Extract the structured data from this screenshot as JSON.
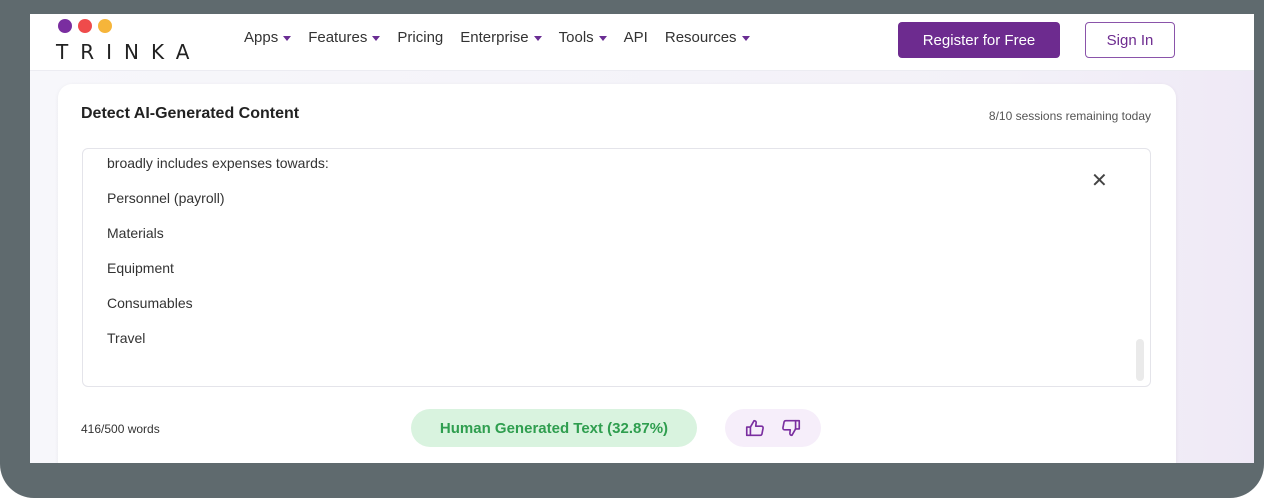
{
  "brand": {
    "name": "TRINKA",
    "dot_colors": [
      "#7a2ea0",
      "#ef4b4b",
      "#f6b53a"
    ]
  },
  "nav": {
    "items": [
      {
        "label": "Apps",
        "has_dropdown": true
      },
      {
        "label": "Features",
        "has_dropdown": true
      },
      {
        "label": "Pricing",
        "has_dropdown": false
      },
      {
        "label": "Enterprise",
        "has_dropdown": true
      },
      {
        "label": "Tools",
        "has_dropdown": true
      },
      {
        "label": "API",
        "has_dropdown": false
      },
      {
        "label": "Resources",
        "has_dropdown": true
      }
    ],
    "register_label": "Register for Free",
    "signin_label": "Sign In"
  },
  "detector": {
    "title": "Detect AI-Generated Content",
    "sessions": "8/10 sessions remaining today",
    "text_lines": [
      "broadly includes expenses towards:",
      "Personnel (payroll)",
      "Materials",
      "Equipment",
      "Consumables",
      "Travel"
    ],
    "close_icon": "close-icon",
    "word_count": "416/500 words",
    "result": "Human Generated Text (32.87%)",
    "result_color": "#2f9e4f",
    "feedback_icons": [
      "thumbs-up-icon",
      "thumbs-down-icon"
    ]
  },
  "colors": {
    "accent": "#6d2b8f",
    "frame": "#5f6a6e"
  }
}
